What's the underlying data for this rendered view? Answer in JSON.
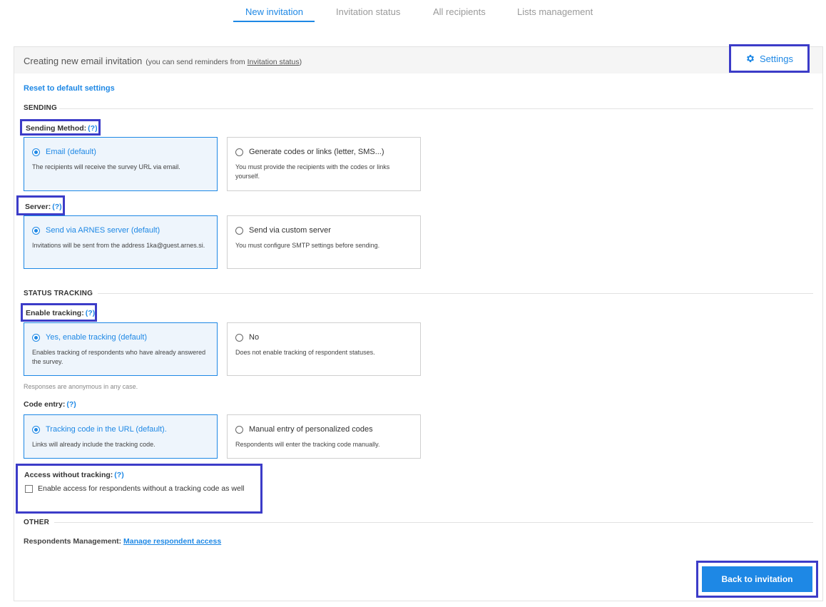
{
  "tabs": [
    {
      "label": "New invitation",
      "active": true
    },
    {
      "label": "Invitation status",
      "active": false
    },
    {
      "label": "All recipients",
      "active": false
    },
    {
      "label": "Lists management",
      "active": false
    }
  ],
  "header": {
    "title": "Creating new email invitation",
    "note_prefix": "(you can send reminders from ",
    "note_link": "Invitation status",
    "note_suffix": ")",
    "settings_label": "Settings",
    "settings_icon": "gear-icon"
  },
  "reset_link": "Reset to default settings",
  "sections": {
    "sending": "SENDING",
    "status_tracking": "STATUS TRACKING",
    "other": "OTHER"
  },
  "help": "(?)",
  "sending_method": {
    "label": "Sending Method:",
    "options": [
      {
        "title": "Email (default)",
        "desc": "The recipients will receive the survey URL via email.",
        "selected": true
      },
      {
        "title": "Generate codes or links (letter, SMS...)",
        "desc": "You must provide the recipients with the codes or links yourself.",
        "selected": false
      }
    ]
  },
  "server": {
    "label": "Server:",
    "options": [
      {
        "title": "Send via ARNES server (default)",
        "desc": "Invitations will be sent from the address 1ka@guest.arnes.si.",
        "selected": true
      },
      {
        "title": "Send via custom server",
        "desc": "You must configure SMTP settings before sending.",
        "selected": false
      }
    ]
  },
  "tracking": {
    "label": "Enable tracking:",
    "options": [
      {
        "title": "Yes, enable tracking (default)",
        "desc": "Enables tracking of respondents who have already answered the survey.",
        "selected": true
      },
      {
        "title": "No",
        "desc": "Does not enable tracking of respondent statuses.",
        "selected": false
      }
    ],
    "note": "Responses are anonymous in any case."
  },
  "code_entry": {
    "label": "Code entry:",
    "options": [
      {
        "title": "Tracking code in the URL (default).",
        "desc": "Links will already include the tracking code.",
        "selected": true
      },
      {
        "title": "Manual entry of personalized codes",
        "desc": "Respondents will enter the tracking code manually.",
        "selected": false
      }
    ]
  },
  "access": {
    "label": "Access without tracking:",
    "checkbox_label": "Enable access for respondents without a tracking code as well",
    "checked": false
  },
  "respondents_management": {
    "label": "Respondents Management:",
    "link": "Manage respondent access"
  },
  "back_button": "Back to invitation",
  "colors": {
    "accent": "#1e88e5",
    "highlight": "#3c3cc8",
    "selected_bg": "#eef5fc"
  }
}
